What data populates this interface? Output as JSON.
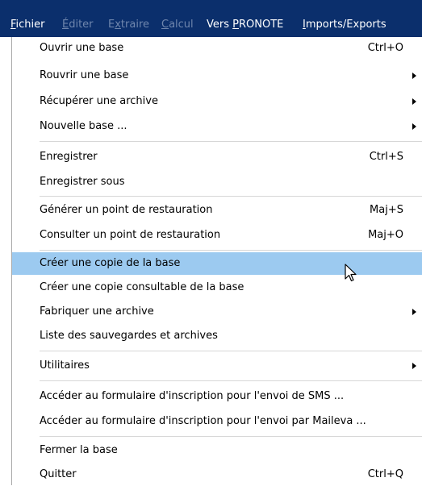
{
  "menubar": {
    "fichier": {
      "pre": "",
      "u": "F",
      "post": "ichier"
    },
    "editer": {
      "pre": "",
      "u": "É",
      "post": "diter"
    },
    "extraire": {
      "pre": "E",
      "u": "x",
      "post": "traire"
    },
    "calcul": {
      "pre": "",
      "u": "C",
      "post": "alcul"
    },
    "vers_pronote": {
      "pre": "Vers ",
      "u": "P",
      "post": "RONOTE"
    },
    "imports_exports": {
      "pre": "",
      "u": "I",
      "post": "mports/Exports"
    }
  },
  "menu": {
    "ouvrir": {
      "label": "Ouvrir une base",
      "shortcut": "Ctrl+O"
    },
    "rouvrir": {
      "label": "Rouvrir une base"
    },
    "recuperer": {
      "label": "Récupérer une archive"
    },
    "nouvelle": {
      "label": "Nouvelle base ..."
    },
    "enregistrer": {
      "label": "Enregistrer",
      "shortcut": "Ctrl+S"
    },
    "enregistrer_sous": {
      "label": "Enregistrer sous"
    },
    "generer_point": {
      "label": "Générer un point de restauration",
      "shortcut": "Maj+S"
    },
    "consulter_point": {
      "label": "Consulter un point de restauration",
      "shortcut": "Maj+O"
    },
    "creer_copie": {
      "label": "Créer une copie de la base"
    },
    "creer_copie_consultable": {
      "label": "Créer une copie consultable de la base"
    },
    "fabriquer_archive": {
      "label": "Fabriquer une archive"
    },
    "liste_sauvegardes": {
      "label": "Liste des sauvegardes et archives"
    },
    "utilitaires": {
      "label": "Utilitaires"
    },
    "formulaire_sms": {
      "label": "Accéder au formulaire d'inscription pour l'envoi de SMS ..."
    },
    "formulaire_maileva": {
      "label": "Accéder au formulaire d'inscription pour l'envoi par Maileva ..."
    },
    "fermer": {
      "label": "Fermer la base"
    },
    "quitter": {
      "label": "Quitter",
      "shortcut": "Ctrl+Q"
    }
  },
  "colors": {
    "menubar_bg": "#0b2f6c",
    "menubar_text": "#ffffff",
    "menubar_disabled": "#6f86ad",
    "highlight": "#9ccaf0",
    "separator": "#d7d7d7"
  }
}
